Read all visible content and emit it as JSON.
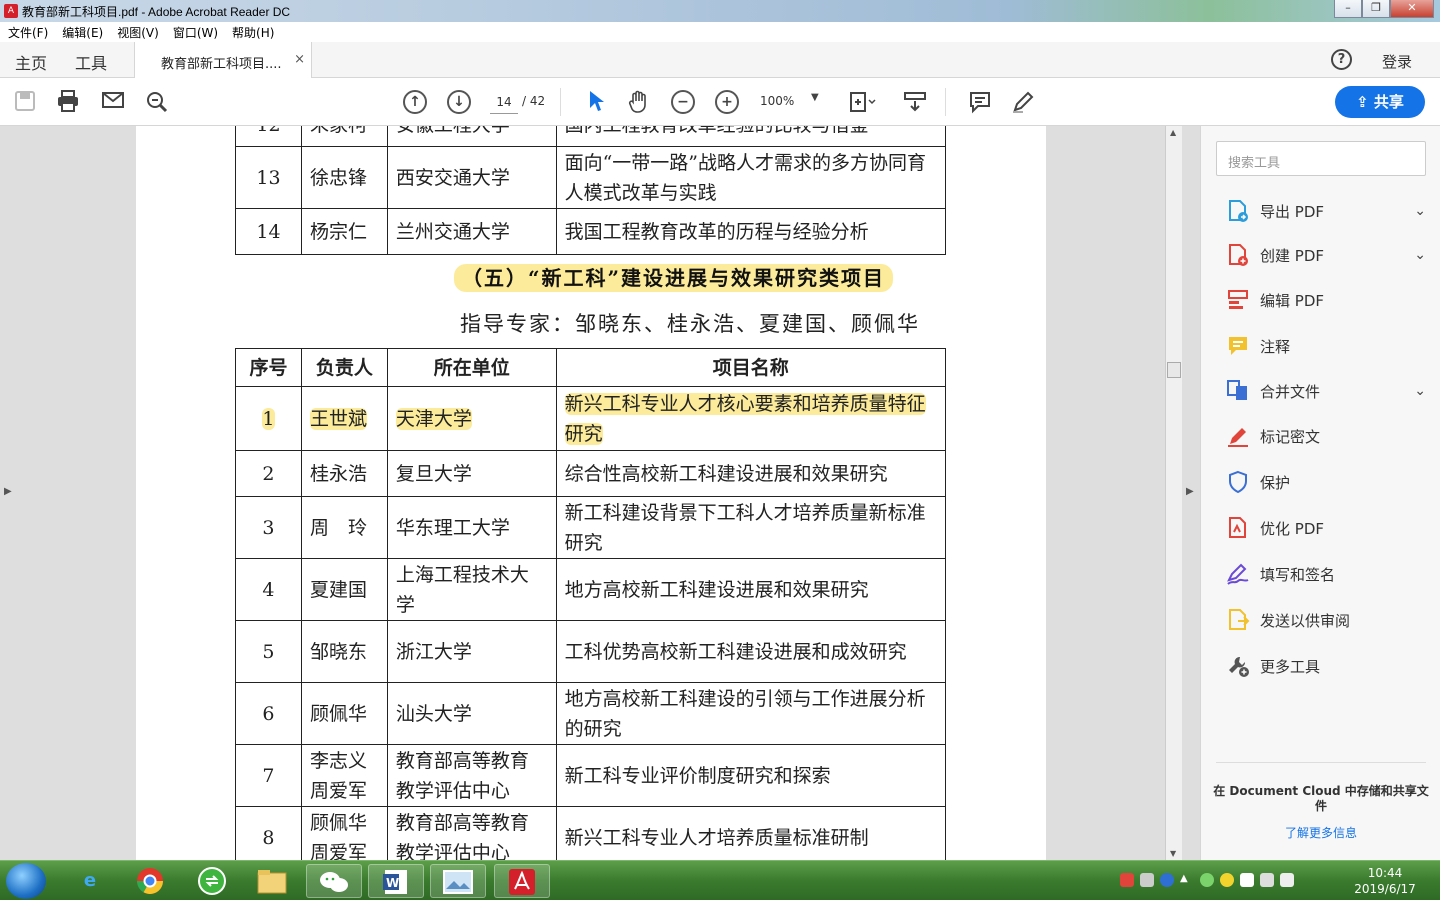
{
  "window": {
    "title": "教育部新工科项目.pdf - Adobe Acrobat Reader DC"
  },
  "menu": [
    "文件(F)",
    "编辑(E)",
    "视图(V)",
    "窗口(W)",
    "帮助(H)"
  ],
  "tabs": {
    "home": "主页",
    "tools": "工具",
    "doc": "教育部新工科项目....",
    "close": "×"
  },
  "header": {
    "help": "?",
    "login": "登录"
  },
  "toolbar": {
    "page_current": "14",
    "page_total": "/ 42",
    "zoom": "100%",
    "share": "共享"
  },
  "pdf": {
    "prev_rows": [
      {
        "num": "13",
        "person": "徐忠锋",
        "unit": "西安交通大学",
        "project": "面向“一带一路”战略人才需求的多方协同育人模式改革与实践"
      },
      {
        "num": "14",
        "person": "杨宗仁",
        "unit": "兰州交通大学",
        "project": "我国工程教育改革的历程与经验分析"
      }
    ],
    "section_title": "（五）“新工科”建设进展与效果研究类项目",
    "experts": "指导专家：邹晓东、桂永浩、夏建国、顾佩华",
    "headers": {
      "num": "序号",
      "person": "负责人",
      "unit": "所在单位",
      "project": "项目名称"
    },
    "rows": [
      {
        "num": "1",
        "person": "王世斌",
        "unit": "天津大学",
        "project": "新兴工科专业人才核心要素和培养质量特征研究"
      },
      {
        "num": "2",
        "person": "桂永浩",
        "unit": "复旦大学",
        "project": "综合性高校新工科建设进展和效果研究"
      },
      {
        "num": "3",
        "person": "周　玲",
        "unit": "华东理工大学",
        "project": "新工科建设背景下工科人才培养质量新标准研究"
      },
      {
        "num": "4",
        "person": "夏建国",
        "unit": "上海工程技术大学",
        "project": "地方高校新工科建设进展和效果研究"
      },
      {
        "num": "5",
        "person": "邹晓东",
        "unit": "浙江大学",
        "project": "工科优势高校新工科建设进展和成效研究"
      },
      {
        "num": "6",
        "person": "顾佩华",
        "unit": "汕头大学",
        "project": "地方高校新工科建设的引领与工作进展分析的研究"
      },
      {
        "num": "7",
        "person": "李志义周爱军",
        "unit": "教育部高等教育教学评估中心",
        "project": "新工科专业评价制度研究和探索"
      },
      {
        "num": "8",
        "person": "顾佩华周爱军",
        "unit": "教育部高等教育教学评估中心",
        "project": "新兴工科专业人才培养质量标准研制"
      }
    ]
  },
  "sidebar": {
    "search_placeholder": "搜索工具",
    "items": [
      {
        "label": "导出 PDF",
        "color": "#2d9cdb"
      },
      {
        "label": "创建 PDF",
        "color": "#e0443a"
      },
      {
        "label": "编辑 PDF",
        "color": "#e0443a"
      },
      {
        "label": "注释",
        "color": "#f2c12e"
      },
      {
        "label": "合并文件",
        "color": "#3b6fd4"
      },
      {
        "label": "标记密文",
        "color": "#e0443a"
      },
      {
        "label": "保护",
        "color": "#3b6fd4"
      },
      {
        "label": "优化 PDF",
        "color": "#e0443a"
      },
      {
        "label": "填写和签名",
        "color": "#6a4bd6"
      },
      {
        "label": "发送以供审阅",
        "color": "#f2c12e"
      },
      {
        "label": "更多工具",
        "color": "#555555"
      }
    ],
    "cloud_text": "在 Document Cloud 中存储和共享文件",
    "learn_more": "了解更多信息"
  },
  "taskbar": {
    "time": "10:44",
    "date": "2019/6/17"
  }
}
